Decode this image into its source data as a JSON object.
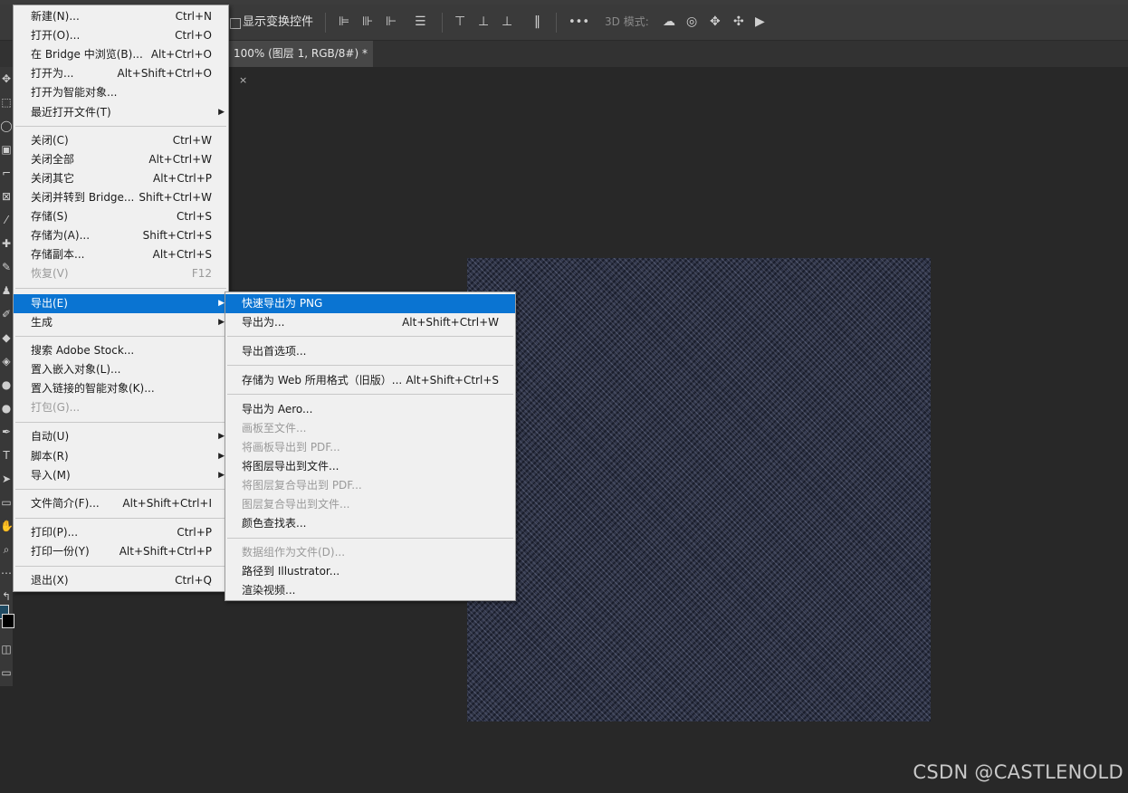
{
  "options_bar": {
    "show_transform_label": "显示变换控件",
    "mode_label": "3D 模式:",
    "more_label": "•••"
  },
  "document_tab": {
    "title": "100% (图层 1, RGB/8#) *",
    "close": "×"
  },
  "file_menu": {
    "items": [
      {
        "label": "新建(N)...",
        "shortcut": "Ctrl+N"
      },
      {
        "label": "打开(O)...",
        "shortcut": "Ctrl+O"
      },
      {
        "label": "在 Bridge 中浏览(B)...",
        "shortcut": "Alt+Ctrl+O"
      },
      {
        "label": "打开为...",
        "shortcut": "Alt+Shift+Ctrl+O"
      },
      {
        "label": "打开为智能对象..."
      },
      {
        "label": "最近打开文件(T)"
      },
      {
        "label": "关闭(C)",
        "shortcut": "Ctrl+W"
      },
      {
        "label": "关闭全部",
        "shortcut": "Alt+Ctrl+W"
      },
      {
        "label": "关闭其它",
        "shortcut": "Alt+Ctrl+P"
      },
      {
        "label": "关闭并转到 Bridge...",
        "shortcut": "Shift+Ctrl+W"
      },
      {
        "label": "存储(S)",
        "shortcut": "Ctrl+S"
      },
      {
        "label": "存储为(A)...",
        "shortcut": "Shift+Ctrl+S"
      },
      {
        "label": "存储副本...",
        "shortcut": "Alt+Ctrl+S"
      },
      {
        "label": "恢复(V)",
        "shortcut": "F12"
      },
      {
        "label": "导出(E)"
      },
      {
        "label": "生成"
      },
      {
        "label": "搜索 Adobe Stock..."
      },
      {
        "label": "置入嵌入对象(L)..."
      },
      {
        "label": "置入链接的智能对象(K)..."
      },
      {
        "label": "打包(G)..."
      },
      {
        "label": "自动(U)"
      },
      {
        "label": "脚本(R)"
      },
      {
        "label": "导入(M)"
      },
      {
        "label": "文件简介(F)...",
        "shortcut": "Alt+Shift+Ctrl+I"
      },
      {
        "label": "打印(P)...",
        "shortcut": "Ctrl+P"
      },
      {
        "label": "打印一份(Y)",
        "shortcut": "Alt+Shift+Ctrl+P"
      },
      {
        "label": "退出(X)",
        "shortcut": "Ctrl+Q"
      }
    ]
  },
  "export_menu": {
    "items": [
      {
        "label": "快速导出为 PNG"
      },
      {
        "label": "导出为...",
        "shortcut": "Alt+Shift+Ctrl+W"
      },
      {
        "label": "导出首选项..."
      },
      {
        "label": "存储为 Web 所用格式（旧版）...",
        "shortcut": "Alt+Shift+Ctrl+S"
      },
      {
        "label": "导出为 Aero..."
      },
      {
        "label": "画板至文件..."
      },
      {
        "label": "将画板导出到 PDF..."
      },
      {
        "label": "将图层导出到文件..."
      },
      {
        "label": "将图层复合导出到 PDF..."
      },
      {
        "label": "图层复合导出到文件..."
      },
      {
        "label": "颜色查找表..."
      },
      {
        "label": "数据组作为文件(D)..."
      },
      {
        "label": "路径到 Illustrator..."
      },
      {
        "label": "渲染视频..."
      }
    ]
  },
  "watermark": "CSDN @CASTLENOLD",
  "colors": {
    "menu_highlight": "#0a74d2",
    "app_background": "#282828",
    "fabric": "#2e3346"
  }
}
